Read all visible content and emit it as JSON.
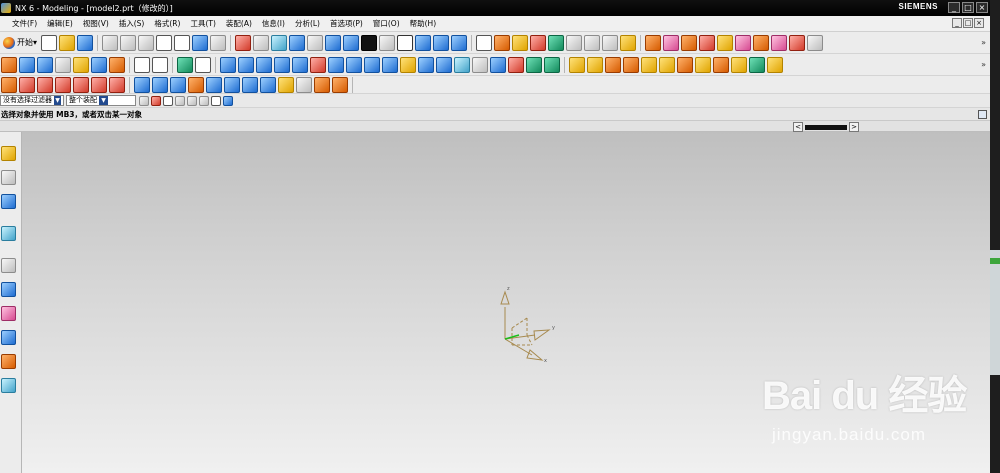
{
  "window": {
    "title": "NX 6 - Modeling - [model2.prt（修改的）]",
    "brand": "SIEMENS",
    "controls": [
      "_",
      "□",
      "×"
    ],
    "mdi_controls": [
      "_",
      "□",
      "×"
    ]
  },
  "menu": [
    "文件(F)",
    "编辑(E)",
    "视图(V)",
    "插入(S)",
    "格式(R)",
    "工具(T)",
    "装配(A)",
    "信息(I)",
    "分析(L)",
    "首选项(P)",
    "窗口(O)",
    "帮助(H)"
  ],
  "toolbar": {
    "start_label": "开始▾",
    "overflow": "»"
  },
  "selection_bar": {
    "filter_value": "没有选择过滤器",
    "scope_value": "整个装配"
  },
  "status": {
    "prompt": "选择对象并使用 MB3，或者双击某一对象"
  },
  "colors": {
    "titlebar": "#000000",
    "viewport_top": "#bfbfbf",
    "viewport_bottom": "#f0f0f0",
    "csys_axis": "#a78a4f",
    "csys_green": "#18c018"
  },
  "triad": {
    "z_label": "z",
    "y_label": "y",
    "x_label": "x"
  },
  "watermark": {
    "logo": "Bai du 经验",
    "url": "jingyan.baidu.com"
  }
}
